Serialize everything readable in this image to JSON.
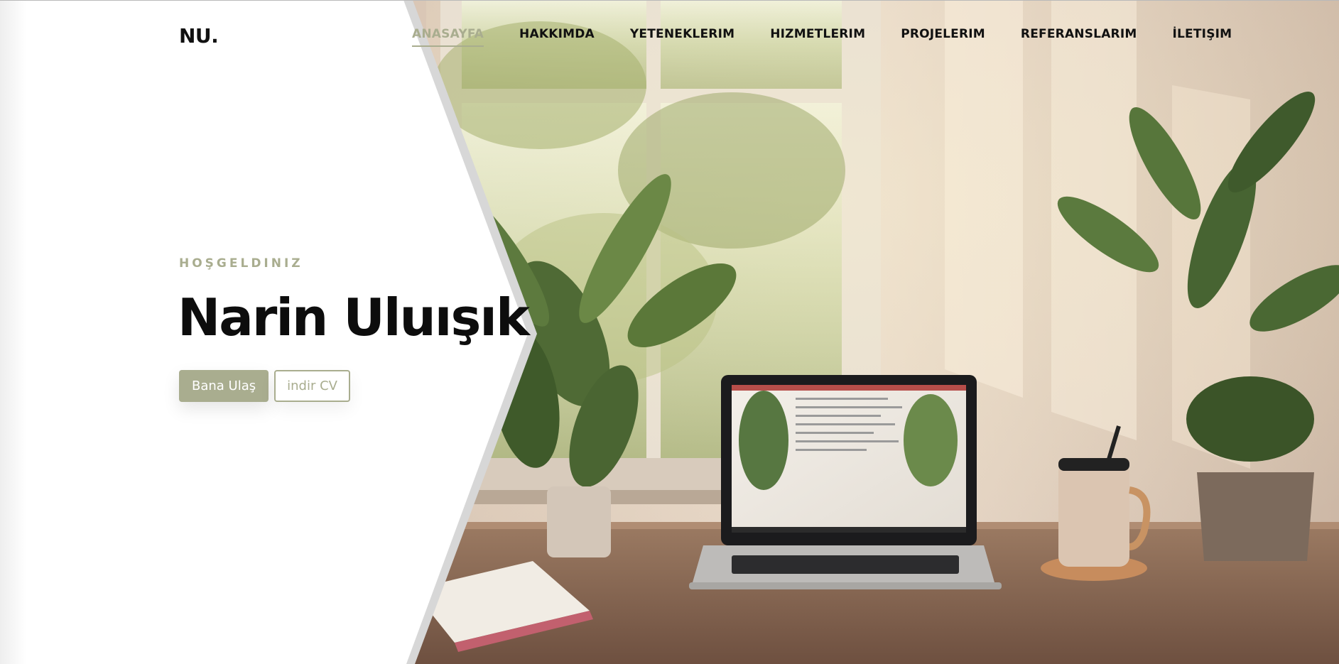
{
  "header": {
    "logo": "NU.",
    "nav": [
      {
        "label": "ANASAYFA",
        "active": true
      },
      {
        "label": "HAKKIMDA",
        "active": false
      },
      {
        "label": "YETENEKLERIM",
        "active": false
      },
      {
        "label": "HIZMETLERIM",
        "active": false
      },
      {
        "label": "PROJELERIM",
        "active": false
      },
      {
        "label": "REFERANSLARIM",
        "active": false
      },
      {
        "label": "İLETIŞIM",
        "active": false
      }
    ]
  },
  "hero": {
    "eyebrow": "HOŞGELDINIZ",
    "title": "Narin Uluışık",
    "buttons": {
      "primary_label": "Bana Ulaş",
      "secondary_label": "indir CV"
    },
    "background_image": "workspace-desk-laptop-plants-photo"
  },
  "colors": {
    "accent": "#a9ad8f",
    "text": "#0d0d0d",
    "panel": "#ffffff"
  }
}
